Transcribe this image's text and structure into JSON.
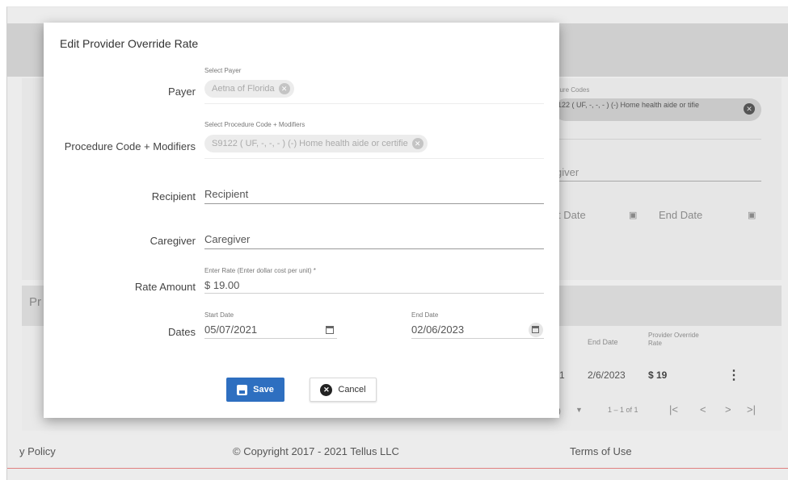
{
  "modal": {
    "title": "Edit Provider Override Rate",
    "payer": {
      "label": "Payer",
      "caption": "Select Payer",
      "chip": "Aetna of Florida"
    },
    "procedure": {
      "label": "Procedure Code + Modifiers",
      "caption": "Select Procedure Code + Modifiers",
      "chip": "S9122 ( UF, -, -, - ) (-) Home health aide or certifie"
    },
    "recipient": {
      "label": "Recipient",
      "value": "Recipient"
    },
    "caregiver": {
      "label": "Caregiver",
      "value": "Caregiver"
    },
    "rate": {
      "label": "Rate Amount",
      "caption": "Enter Rate (Enter dollar cost per unit) *",
      "value": "$ 19.00"
    },
    "dates": {
      "label": "Dates",
      "start_caption": "Start Date",
      "start_value": "05/07/2021",
      "end_caption": "End Date",
      "end_value": "02/06/2023"
    },
    "save_label": "Save",
    "cancel_label": "Cancel"
  },
  "background": {
    "procedure_codes_caption": "dure Codes",
    "procedure_chip": "122 ( UF, -, -, - ) (-) Home health aide or tifie",
    "caregiver": "giver",
    "start_date": "t Date",
    "end_date": "End Date",
    "section_title": "Pr",
    "table_headers": {
      "end_date": "End Date",
      "override_rate": "Provider Override Rate"
    },
    "table_row": {
      "col_start": "1",
      "end_date": "2/6/2023",
      "rate": "$ 19"
    },
    "pagination": {
      "page_size_suffix": ")",
      "range": "1 – 1 of 1",
      "first": "|<",
      "prev": "<",
      "next": ">",
      "last": ">|"
    },
    "footer": {
      "privacy": "y Policy",
      "copyright": "© Copyright 2017 - 2021 Tellus LLC",
      "terms": "Terms of Use"
    }
  },
  "colors": {
    "primary": "#2e6fc0",
    "overlay": "#cfcfcf"
  }
}
